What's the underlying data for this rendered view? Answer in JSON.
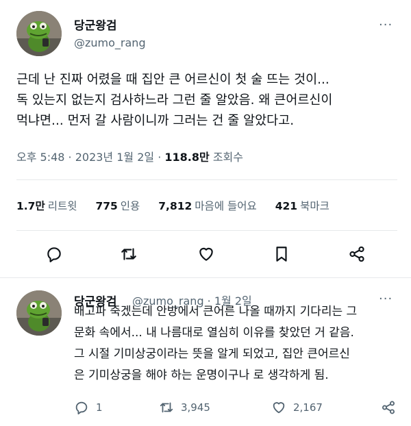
{
  "tweet": {
    "display_name": "당군왕검",
    "handle": "@zumo_rang",
    "more_icon": "more-dots-icon",
    "lines": [
      "근데 난 진짜 어렸을 때 집안 큰 어르신이 첫 술 뜨는 것이...",
      "독 있는지 없는지 검사하느라 그런 줄 알았음. 왜 큰어르신이",
      "먹냐면... 먼저 갈 사람이니까 그러는 건 줄 알았다고."
    ],
    "time": "오후 5:48 · 2023년 1월 2일 · ",
    "views_count": "118.8만",
    "views_label": " 조회수",
    "stats": {
      "retweets_count": "1.7만",
      "retweets_label": "리트윗",
      "quotes_count": "775",
      "quotes_label": "인용",
      "likes_count": "7,812",
      "likes_label": "마음에 들어요",
      "bookmarks_count": "421",
      "bookmarks_label": "북마크"
    }
  },
  "reply": {
    "display_name": "당군왕검",
    "handle": "@zumo_rang · 1월 2일",
    "lines": [
      "배고파 죽겠는데 안방에서 큰어른 나올 때까지 기다리는 그",
      "문화 속에서... 내 나름대로 열심히 이유를 찾았던 거 같음.",
      "그 시절 기미상궁이라는 뜻을 알게 되었고, 집안 큰어르신",
      "은 기미상궁을 해야 하는 운명이구나 로 생각하게 됨."
    ],
    "reply_count": "1",
    "retweet_count": "3,945",
    "like_count": "2,167"
  },
  "colors": {
    "text": "#0f1419",
    "secondary": "#536471",
    "divider": "#e6e9eb"
  }
}
